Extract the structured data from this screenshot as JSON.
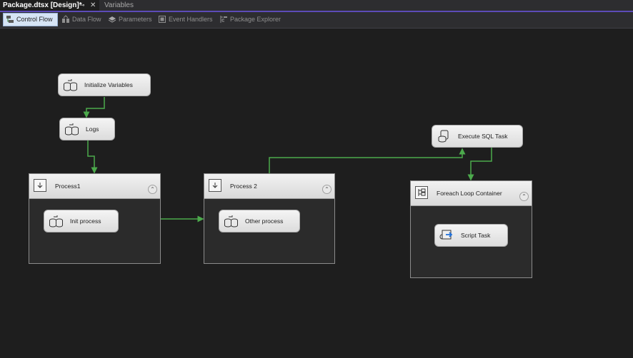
{
  "tabs": {
    "active_title": "Package.dtsx [Design]*",
    "pin_glyph": "⊸",
    "close_glyph": "✕",
    "inactive_title": "Variables"
  },
  "toolbar": {
    "items": [
      {
        "label": "Control Flow",
        "icon": "control-flow-icon"
      },
      {
        "label": "Data Flow",
        "icon": "data-flow-icon"
      },
      {
        "label": "Parameters",
        "icon": "parameters-icon"
      },
      {
        "label": "Event Handlers",
        "icon": "event-handlers-icon"
      },
      {
        "label": "Package Explorer",
        "icon": "package-explorer-icon"
      }
    ],
    "selected": "Control Flow"
  },
  "tasks": {
    "initialize_variables": "Initialize Variables",
    "logs": "Logs",
    "execute_sql": "Execute SQL Task",
    "init_process": "Init process",
    "other_process": "Other process",
    "script_task": "Script Task"
  },
  "containers": {
    "process1": "Process1",
    "process2": "Process 2",
    "foreach": "Foreach Loop Container"
  },
  "colors": {
    "background": "#1e1e1e",
    "accent": "#5c4bb8",
    "connector": "#4caa4c",
    "selected_tab": "#d6e4f5"
  }
}
